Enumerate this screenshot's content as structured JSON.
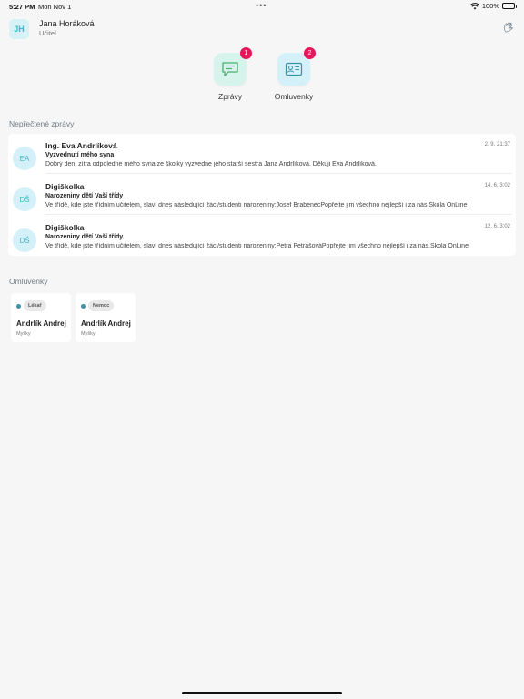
{
  "statusbar": {
    "time": "5:27 PM",
    "date": "Mon Nov 1",
    "battery": "100%"
  },
  "user": {
    "initials": "JH",
    "name": "Jana Horáková",
    "role": "Učitel"
  },
  "quick_actions": [
    {
      "label": "Zprávy",
      "badge": "1",
      "icon": "chat-icon"
    },
    {
      "label": "Omluvenky",
      "badge": "2",
      "icon": "id-card-icon"
    }
  ],
  "unread_section_title": "Nepřečtené zprávy",
  "messages": [
    {
      "initials": "EA",
      "from": "Ing. Eva Andrlíková",
      "date": "2. 9. 21:37",
      "subject": "Vyzvednutí mého syna",
      "body": "Dobrý den, zítra odpoledne mého syna ze školky vyzvedne jeho starší sestra Jana Andrlíková. Děkuji Eva Andrlíková."
    },
    {
      "initials": "DŠ",
      "from": "Digiškolka",
      "date": "14. 6. 3:02",
      "subject": "Narozeniny dětí Vaší třídy",
      "body": "Ve třídě, kde jste třídním učitelem, slaví dnes následující žáci/studenti narozeniny:Josef BrabenecPopřejte jim všechno nejlepší i za nás.Škola OnLine"
    },
    {
      "initials": "DŠ",
      "from": "Digiškolka",
      "date": "12. 6. 3:02",
      "subject": "Narozeniny dětí Vaší třídy",
      "body": "Ve třídě, kde jste třídním učitelem, slaví dnes následující žáci/studenti narozeniny:Petra PetrášováPopřejte jim všechno nejlepší i za nás.Škola OnLine"
    }
  ],
  "excuses_section_title": "Omluvenky",
  "excuses": [
    {
      "tag": "Lékař",
      "name": "Andrlík Andrej",
      "place": "Myšky"
    },
    {
      "tag": "Nemoc",
      "name": "Andrlík Andrej",
      "place": "Myšky"
    }
  ],
  "colors": {
    "accent": "#45b6ca",
    "badge": "#e2195b",
    "green_tile": "#d7f4ec",
    "blue_tile": "#d4f0f8"
  }
}
